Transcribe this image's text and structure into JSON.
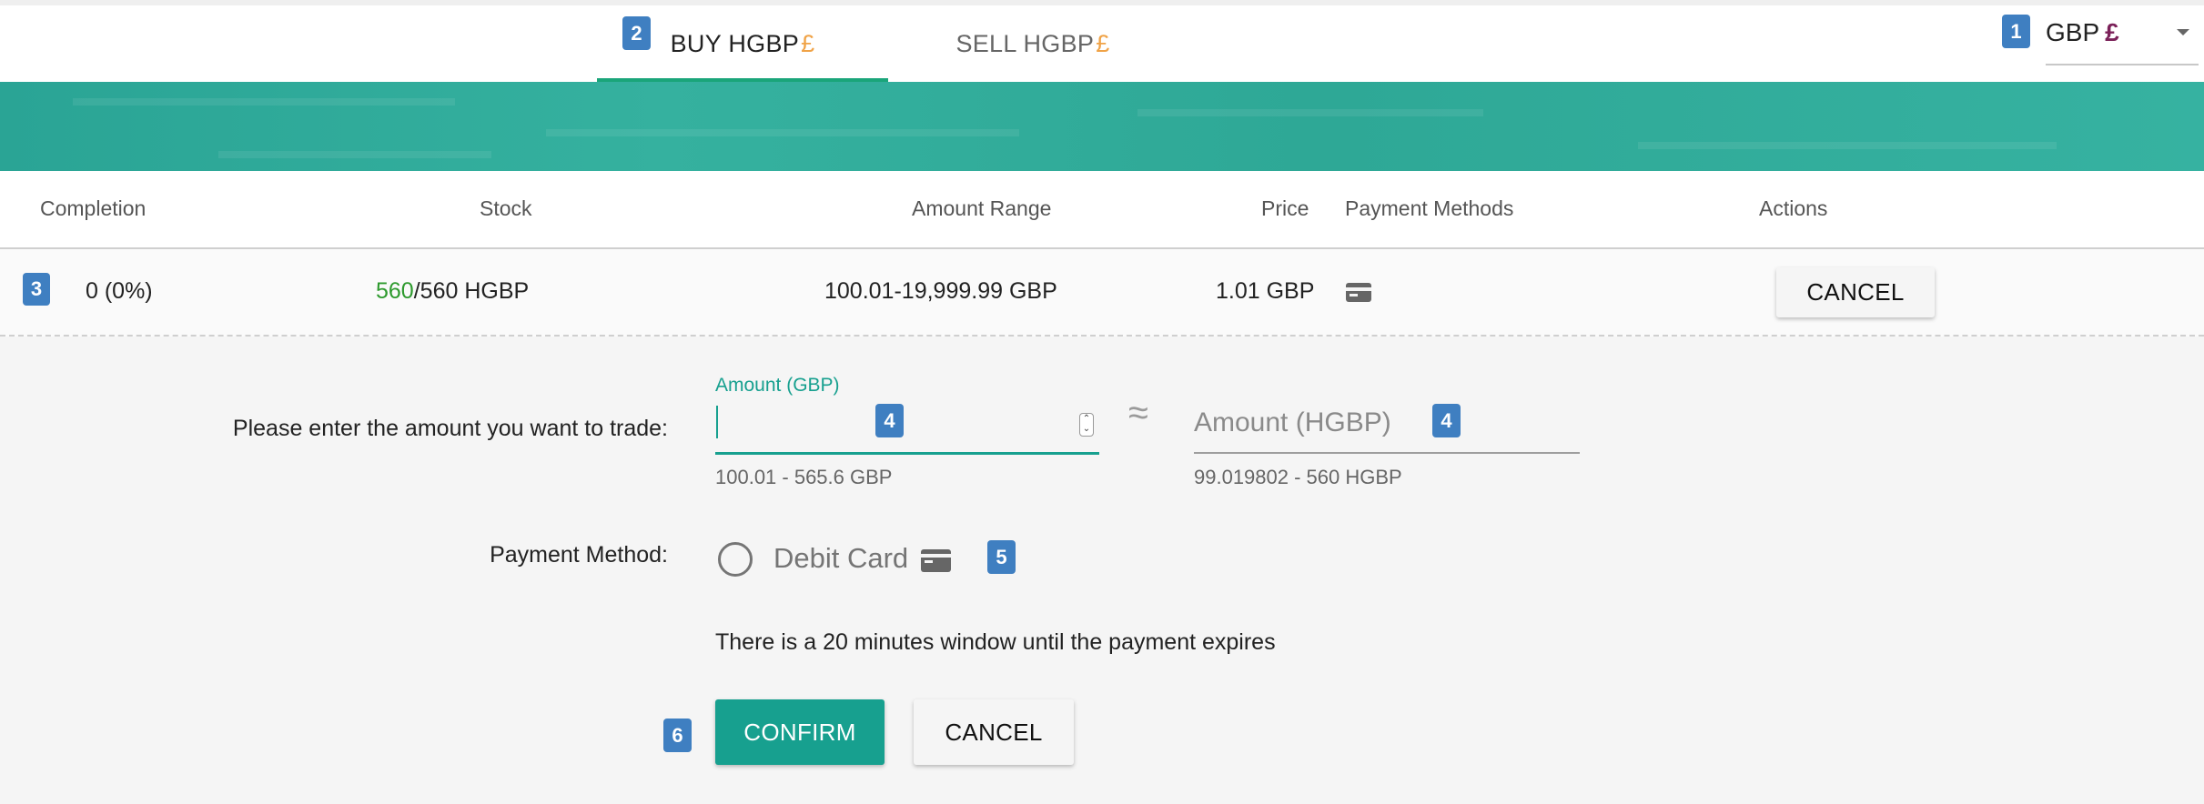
{
  "tabs": {
    "buy": {
      "label": "BUY HGBP",
      "symbol": "£"
    },
    "sell": {
      "label": "SELL HGBP",
      "symbol": "£"
    }
  },
  "currency_select": {
    "value": "GBP",
    "symbol": "£"
  },
  "badges": {
    "b1": "1",
    "b2": "2",
    "b3": "3",
    "b4a": "4",
    "b4b": "4",
    "b5": "5",
    "b6": "6"
  },
  "table": {
    "headers": [
      "Completion",
      "Stock",
      "Amount Range",
      "Price",
      "Payment Methods",
      "Actions"
    ],
    "row": {
      "completion": "0 (0%)",
      "stock_available": "560",
      "stock_total": "/560 HGBP",
      "amount_range": "100.01-19,999.99 GBP",
      "price": "1.01 GBP",
      "payment_icon": "credit-card-icon",
      "action_label": "CANCEL"
    }
  },
  "form": {
    "prompt": "Please enter the amount you want to trade:",
    "amount_gbp": {
      "label": "Amount (GBP)",
      "value": "",
      "hint": "100.01 - 565.6 GBP"
    },
    "approx_symbol": "≈",
    "amount_hgbp": {
      "placeholder": "Amount (HGBP)",
      "hint": "99.019802 - 560 HGBP"
    },
    "payment_method_label": "Payment Method:",
    "payment_option": "Debit Card",
    "notice": "There is a 20 minutes window until the payment expires",
    "confirm_label": "CONFIRM",
    "cancel_label": "CANCEL"
  },
  "colors": {
    "accent": "#17a08f",
    "tab_underline": "#1aa57a",
    "pound_symbol": "#f0a347",
    "badge": "#3f7fc1",
    "stock_green": "#2e9a2e"
  }
}
